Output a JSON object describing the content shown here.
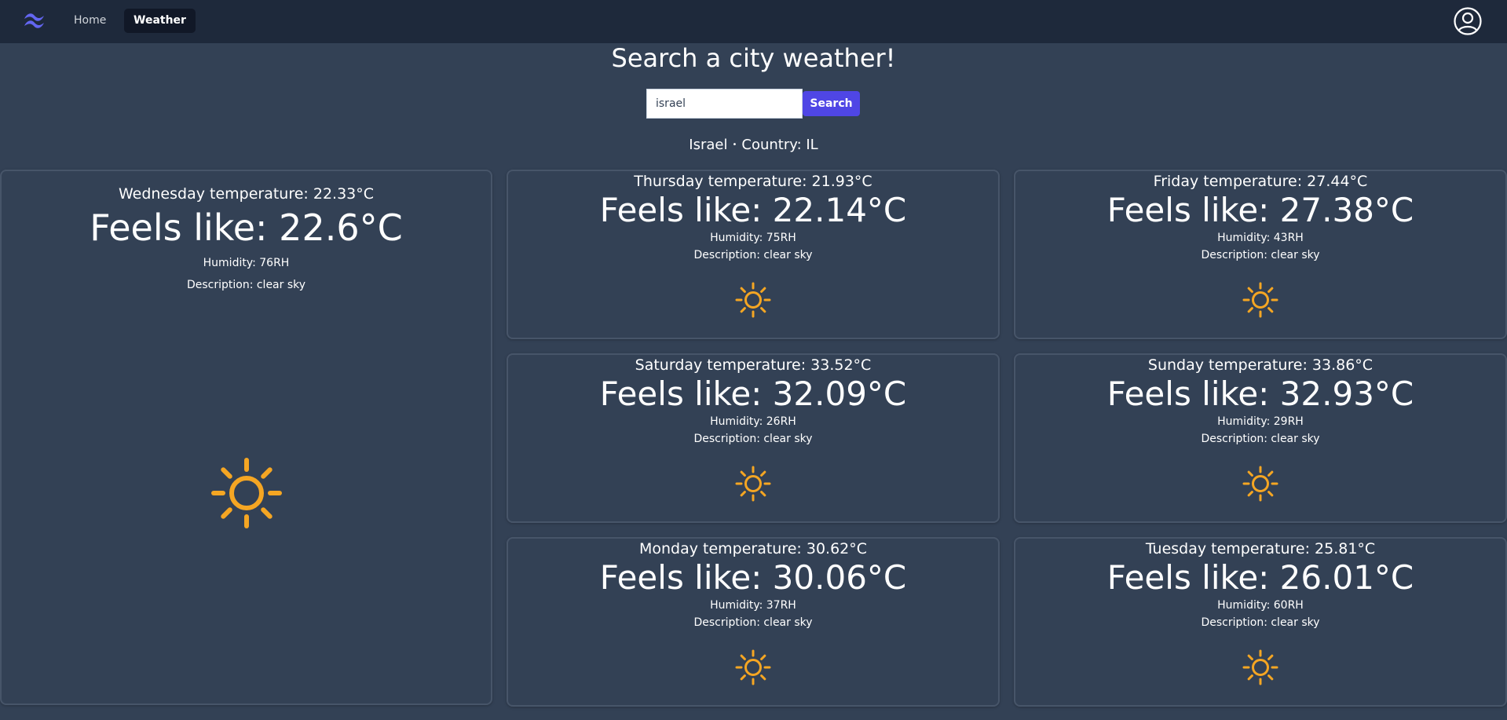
{
  "nav": {
    "home_label": "Home",
    "weather_label": "Weather",
    "logo_icon": "tailwind-logo-icon",
    "user_icon": "user-circle-icon"
  },
  "heading": "Search a city weather!",
  "search": {
    "value": "israel",
    "button_label": "Search"
  },
  "location": {
    "city": "Israel",
    "separator": "•",
    "country": "Country: IL"
  },
  "colors": {
    "background": "#334155",
    "navbar": "#1e293b",
    "accent": "#4f46e5",
    "sun": "#f5a623"
  },
  "forecast": [
    {
      "temperature": "Wednesday temperature: 22.33°C",
      "feels_like": "Feels like: 22.6°C",
      "humidity": "Humidity: 76RH",
      "description": "Description: clear sky",
      "icon": "sun-icon"
    },
    {
      "temperature": "Thursday temperature: 21.93°C",
      "feels_like": "Feels like: 22.14°C",
      "humidity": "Humidity: 75RH",
      "description": "Description: clear sky",
      "icon": "sun-icon"
    },
    {
      "temperature": "Friday temperature: 27.44°C",
      "feels_like": "Feels like: 27.38°C",
      "humidity": "Humidity: 43RH",
      "description": "Description: clear sky",
      "icon": "sun-icon"
    },
    {
      "temperature": "Saturday temperature: 33.52°C",
      "feels_like": "Feels like: 32.09°C",
      "humidity": "Humidity: 26RH",
      "description": "Description: clear sky",
      "icon": "sun-icon"
    },
    {
      "temperature": "Sunday temperature: 33.86°C",
      "feels_like": "Feels like: 32.93°C",
      "humidity": "Humidity: 29RH",
      "description": "Description: clear sky",
      "icon": "sun-icon"
    },
    {
      "temperature": "Monday temperature: 30.62°C",
      "feels_like": "Feels like: 30.06°C",
      "humidity": "Humidity: 37RH",
      "description": "Description: clear sky",
      "icon": "sun-icon"
    },
    {
      "temperature": "Tuesday temperature: 25.81°C",
      "feels_like": "Feels like: 26.01°C",
      "humidity": "Humidity: 60RH",
      "description": "Description: clear sky",
      "icon": "sun-icon"
    }
  ]
}
